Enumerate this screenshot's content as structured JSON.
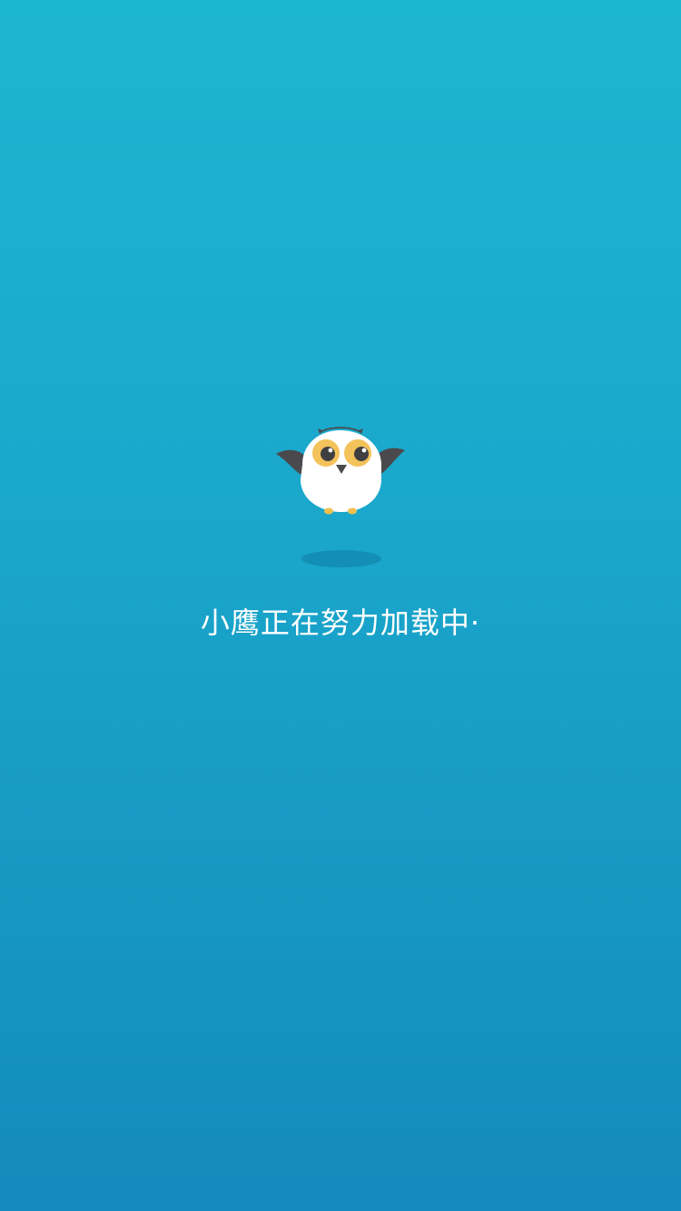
{
  "loading": {
    "message": "小鹰正在努力加载中·"
  },
  "mascot": {
    "icon": "owl-mascot-icon",
    "body_color": "#ffffff",
    "wing_color": "#4a4a4d",
    "eye_color": "#f3c25a",
    "feet_color": "#f0c050"
  },
  "theme": {
    "background_top": "#1db6d0",
    "background_bottom": "#138abb",
    "text_color": "#ffffff"
  }
}
